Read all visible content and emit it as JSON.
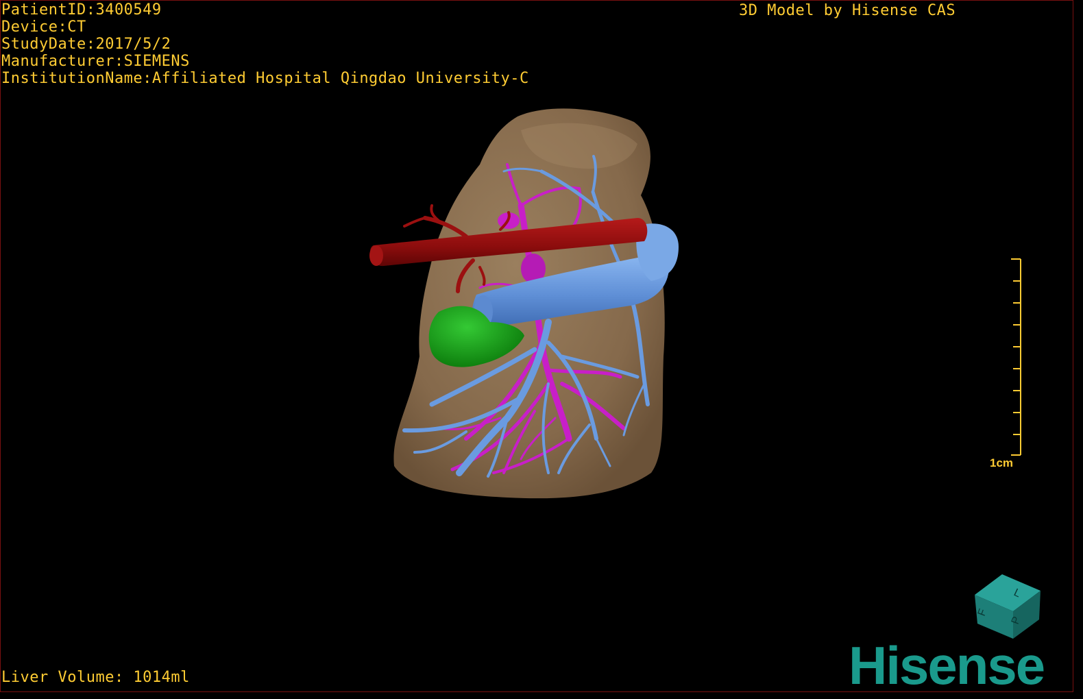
{
  "header": {
    "patient_id": "PatientID:3400549",
    "device": "Device:CT",
    "study_date": "StudyDate:2017/5/2",
    "manufacturer": "Manufacturer:SIEMENS",
    "institution": "InstitutionName:Affiliated Hospital Qingdao University-C"
  },
  "credit": "3D Model by Hisense CAS",
  "footer": {
    "liver_volume": "Liver Volume: 1014ml"
  },
  "scale_bar": {
    "label": "1cm"
  },
  "orientation_cube": {
    "labels": [
      "F",
      "L",
      "P"
    ]
  },
  "logo": {
    "text": "Hisense"
  },
  "colors": {
    "text": "#ffcc33",
    "liver": "#8e7355",
    "portal_vein": "#6a9be0",
    "hepatic_artery": "#9b1010",
    "hepatic_vein": "#c81fc8",
    "gallbladder": "#1aa11a",
    "brand": "#1a9a8c"
  }
}
